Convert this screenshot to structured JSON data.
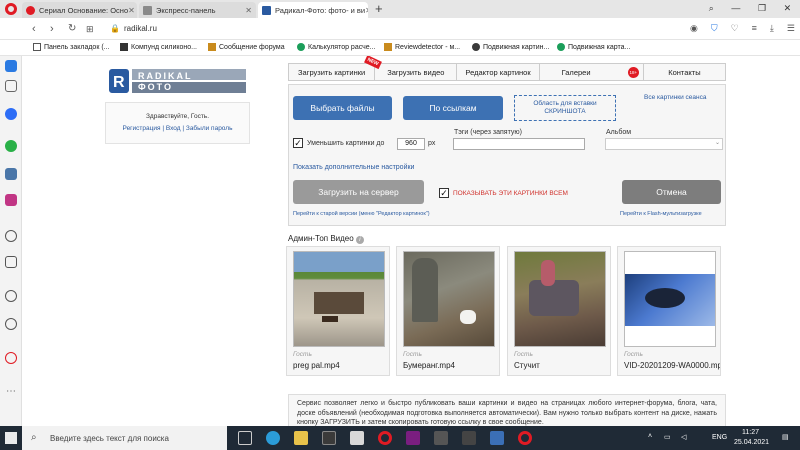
{
  "browser": {
    "tabs": [
      {
        "title": "Сериал Основание: Осно"
      },
      {
        "title": "Экспресс-панель"
      },
      {
        "title": "Радикал-Фото: фото- и ви"
      }
    ],
    "new_tab": "+",
    "url": "radikal.ru",
    "bookmarks": [
      {
        "label": "Панель закладок (..."
      },
      {
        "label": "Компунд силиконо..."
      },
      {
        "label": "Сообщение форума"
      },
      {
        "label": "Калькулятор расче..."
      },
      {
        "label": "Reviewdetector - м..."
      },
      {
        "label": "Подвижная картин..."
      },
      {
        "label": "Подвижная карта..."
      }
    ]
  },
  "site": {
    "logo_text": "RADIKAL ФОТО",
    "greeting": "Здравствуйте, Гость.",
    "auth_links": [
      "Регистрация",
      "Вход",
      "Забыли пароль"
    ],
    "auth_sep": "|",
    "nav": [
      "Загрузить картинки",
      "Загрузить видео",
      "Редактор картинок",
      "Галереи",
      "Контакты"
    ],
    "nav_badge_new": "NEW",
    "nav_badge_count": "18+",
    "upload": {
      "select_files": "Выбрать файлы",
      "by_links": "По ссылкам",
      "paste_area": "Область для вставки СКРИНШОТА",
      "all_session": "Все картинки сеанса",
      "reduce_label": "Уменьшить картинки до",
      "reduce_value": "960",
      "reduce_unit": "px",
      "tags_label": "Тэги (через запятую)",
      "album_label": "Альбом",
      "more_settings": "Показать дополнительные настройки",
      "upload_server": "Загрузить на сервер",
      "show_all": "ПОКАЗЫВАТЬ ЭТИ КАРТИНКИ ВСЕМ",
      "cancel": "Отмена",
      "old_version": "Перейти к старой версии (меню \"Редактор картинок\")",
      "flash": "Перейти к Flash-мультизагрузке"
    },
    "admin_title": "Админ-Топ Видео",
    "videos": [
      {
        "owner": "Гость",
        "name": "preg pal.mp4"
      },
      {
        "owner": "Гость",
        "name": "Бумеранг.mp4"
      },
      {
        "owner": "Гость",
        "name": "Стучит"
      },
      {
        "owner": "Гость",
        "name": "VID-20201209-WA0000.mp4"
      }
    ],
    "about": "Сервис позволяет легко и быстро публиковать ваши картинки и видео на страницах любого интернет-форума, блога, чата, доске объявлений (необходимая подготовка выполняется автоматически). Вам нужно только выбрать контент на диске, нажать кнопку ЗАГРУЗИТЬ и затем скопировать готовую ссылку в свое сообщение."
  },
  "taskbar": {
    "search_placeholder": "Введите здесь текст для поиска",
    "lang": "ENG",
    "time": "11:27",
    "date": "25.04.2021"
  },
  "colors": {
    "accent_blue": "#3d71b3",
    "button_gray": "#7d7d7d",
    "link_blue": "#2a5aa0",
    "opera_red": "#e01b24",
    "taskbar": "#1f2a36"
  }
}
